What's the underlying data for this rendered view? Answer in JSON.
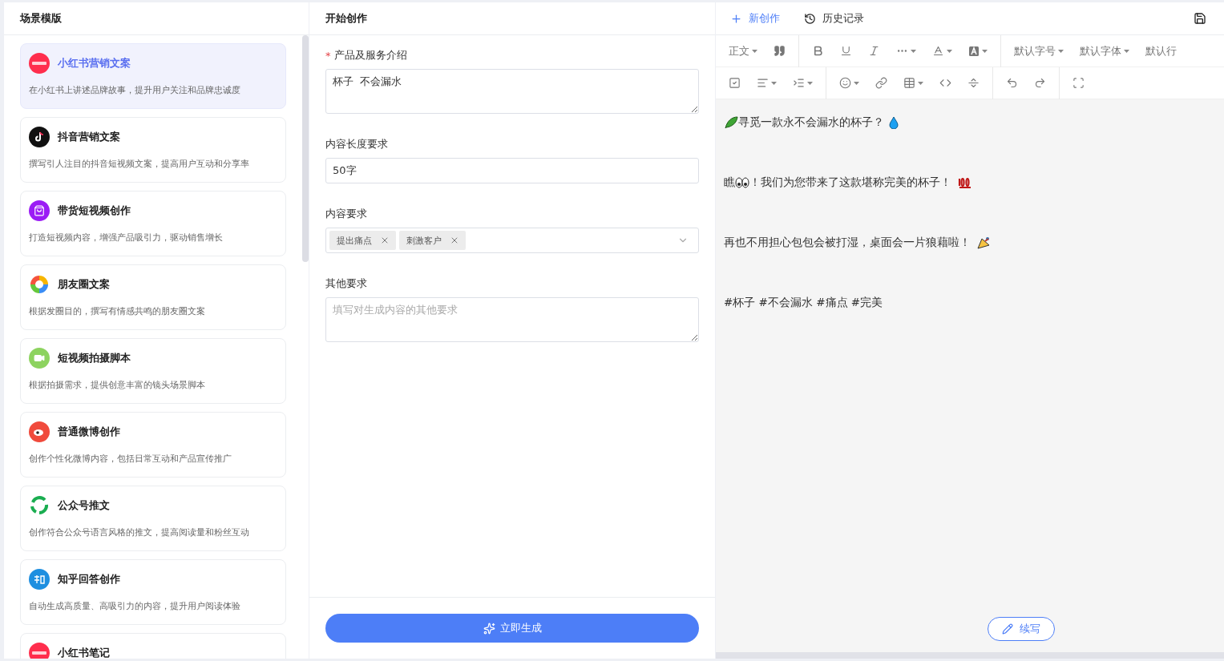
{
  "templates": {
    "title": "场景模版",
    "items": [
      {
        "title": "小红书营销文案",
        "description": "在小红书上讲述品牌故事，提升用户关注和品牌忠诚度",
        "selected": true
      },
      {
        "title": "抖音营销文案",
        "description": "撰写引人注目的抖音短视频文案，提高用户互动和分享率",
        "selected": false
      },
      {
        "title": "带货短视频创作",
        "description": "打造短视频内容，增强产品吸引力，驱动销售增长",
        "selected": false
      },
      {
        "title": "朋友圈文案",
        "description": "根据发圈目的，撰写有情感共鸣的朋友圈文案",
        "selected": false
      },
      {
        "title": "短视频拍摄脚本",
        "description": "根据拍摄需求，提供创意丰富的镜头场景脚本",
        "selected": false
      },
      {
        "title": "普通微博创作",
        "description": "创作个性化微博内容，包括日常互动和产品宣传推广",
        "selected": false
      },
      {
        "title": "公众号推文",
        "description": "创作符合公众号语言风格的推文，提高阅读量和粉丝互动",
        "selected": false
      },
      {
        "title": "知乎回答创作",
        "description": "自动生成高质量、高吸引力的内容，提升用户阅读体验",
        "selected": false
      },
      {
        "title": "小红书笔记",
        "selected": false
      }
    ]
  },
  "form": {
    "title": "开始创作",
    "fields": [
      {
        "kind": "textarea",
        "marker": "*",
        "label": "产品及服务介绍",
        "value": "杯子  不会漏水"
      },
      {
        "kind": "input",
        "label": "内容长度要求",
        "value": "50字"
      },
      {
        "kind": "tags",
        "label": "内容要求",
        "tags": [
          "提出痛点",
          "刺激客户"
        ]
      },
      {
        "kind": "textarea",
        "label": "其他要求",
        "placeholder": "填写对生成内容的其他要求"
      }
    ],
    "submit": "立即生成"
  },
  "editor": {
    "actions": [
      {
        "kind": "new",
        "label": "新创作"
      },
      {
        "kind": "history",
        "label": "历史记录"
      }
    ],
    "toolbar_labels": [
      "正文",
      "默认字号",
      "默认字体",
      "默认行"
    ],
    "paragraphs": [
      [
        {
          "kind": "emoji"
        },
        {
          "kind": "text",
          "text": "寻觅一款永不会漏水的杯子？"
        },
        {
          "kind": "emoji"
        }
      ],
      [
        {
          "kind": "text",
          "text": "瞧"
        },
        {
          "kind": "emoji"
        },
        {
          "kind": "text",
          "text": "！我们为您带来了这款堪称完美的杯子！"
        },
        {
          "kind": "emoji"
        }
      ],
      [
        {
          "kind": "text",
          "text": "再也不用担心包包会被打湿，桌面会一片狼藉啦！"
        },
        {
          "kind": "emoji"
        }
      ],
      [
        {
          "kind": "text",
          "text": "#杯子 #不会漏水 #痛点 #完美"
        }
      ]
    ],
    "continue_button": "续写"
  }
}
